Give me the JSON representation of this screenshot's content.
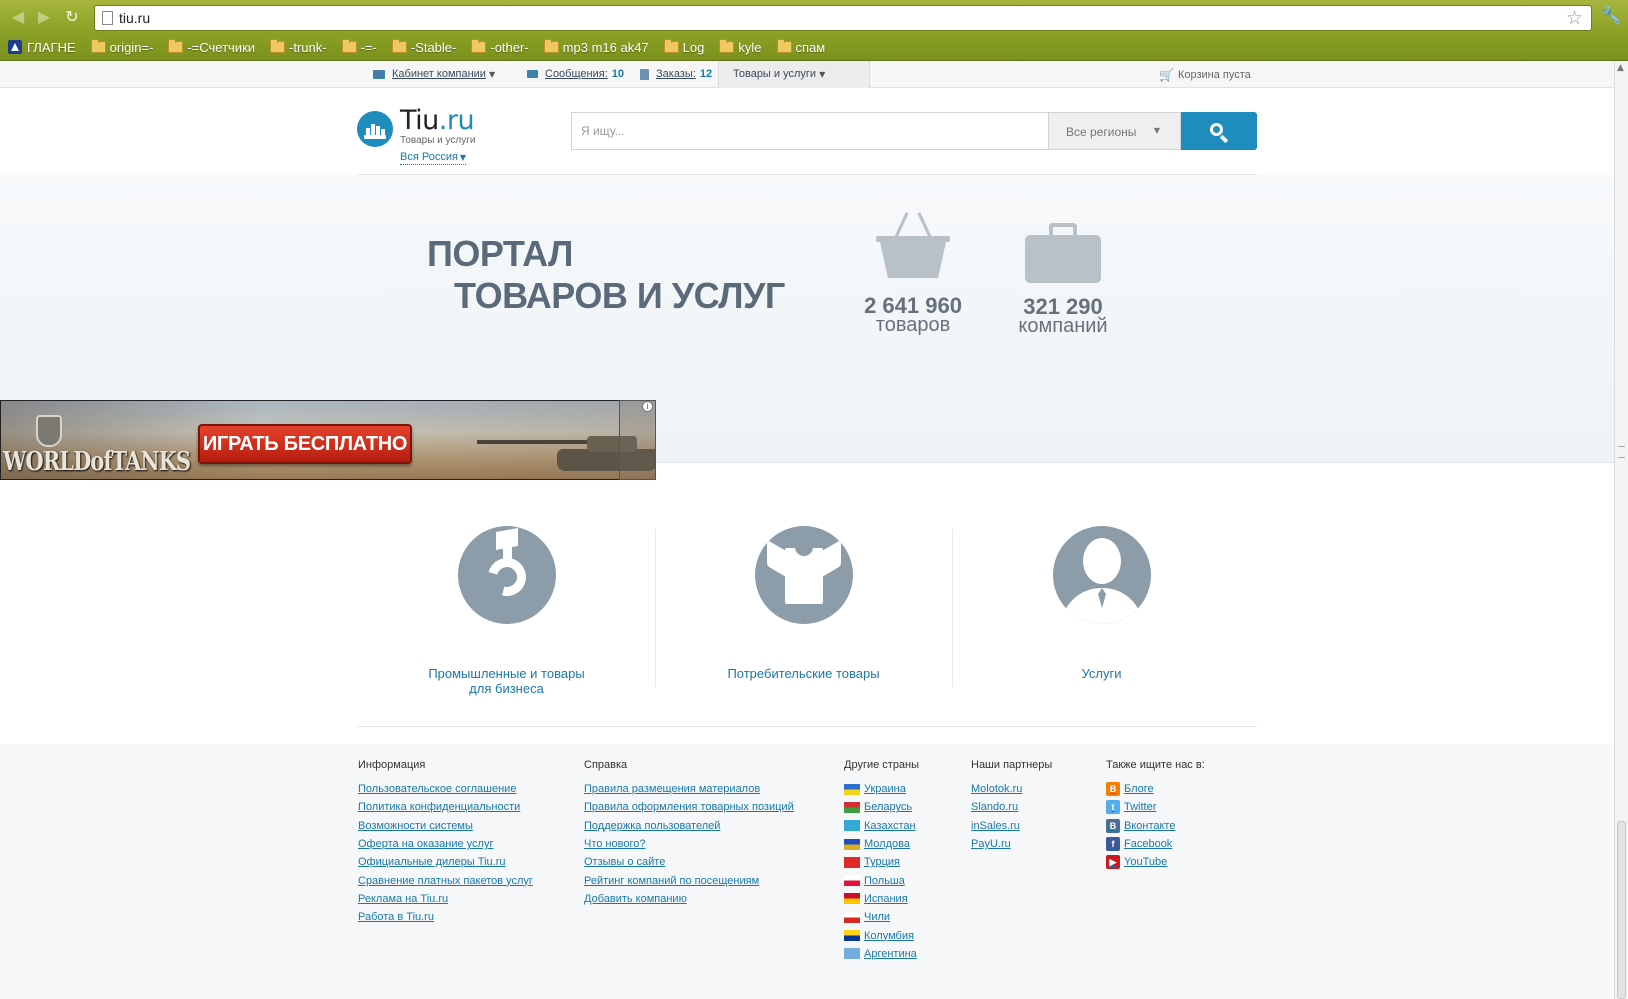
{
  "browser": {
    "url": "tiu.ru",
    "bookmarks": [
      "ГЛАГНЕ",
      "origin=-",
      "-=Счетчики",
      "-trunk-",
      "-=-",
      "-Stable-",
      "-other-",
      "mp3 m16 ak47",
      "Log",
      "kyle",
      "спам"
    ]
  },
  "topbar": {
    "cabinet": "Кабинет компании",
    "messages_label": "Сообщения:",
    "messages_count": "10",
    "orders_label": "Заказы:",
    "orders_count": "12",
    "products_menu": "Товары и услуги",
    "cart": "Корзина пуста"
  },
  "header": {
    "logo_name": "Tiu",
    "logo_tld": ".ru",
    "logo_tagline": "Товары и услуги",
    "region_link": "Вся Россия",
    "search_placeholder": "Я ищу...",
    "region_select": "Все регионы"
  },
  "hero": {
    "title_line1": "ПОРТАЛ",
    "title_line2": "ТОВАРОВ И УСЛУГ",
    "products_count": "2 641 960",
    "products_label": "товаров",
    "companies_count": "321 290",
    "companies_label": "компаний"
  },
  "ad": {
    "logo": "WORLDofTANKS",
    "cta": "ИГРАТЬ БЕСПЛАТНО",
    "info": "i"
  },
  "categories": [
    {
      "line1": "Промышленные и товары",
      "line2": "для бизнеса"
    },
    {
      "line1": "Потребительские товары",
      "line2": ""
    },
    {
      "line1": "Услуги",
      "line2": ""
    }
  ],
  "footer": {
    "info": {
      "title": "Информация",
      "links": [
        "Пользовательское соглашение",
        "Политика конфиденциальности",
        "Возможности системы",
        "Оферта на оказание услуг",
        "Официальные дилеры Tiu.ru",
        "Сравнение платных пакетов услуг",
        "Реклама на Tiu.ru",
        "Работа в Tiu.ru"
      ]
    },
    "help": {
      "title": "Справка",
      "links": [
        "Правила размещения материалов",
        "Правила оформления товарных позиций",
        "Поддержка пользователей",
        "Что нового?",
        "Отзывы о сайте",
        "Рейтинг компаний по посещениям",
        "Добавить компанию"
      ]
    },
    "countries": {
      "title": "Другие страны",
      "links": [
        "Украина",
        "Беларусь",
        "Казахстан",
        "Молдова",
        "Турция",
        "Польша",
        "Испания",
        "Чили",
        "Колумбия",
        "Аргентина"
      ],
      "flag_colors": [
        [
          "#2f6fcf",
          "#f6d41a"
        ],
        [
          "#d22f2f",
          "#3f9c3f"
        ],
        [
          "#33a9d8",
          "#33a9d8"
        ],
        [
          "#2050c0",
          "#d8b020"
        ],
        [
          "#e02a2a",
          "#e02a2a"
        ],
        [
          "#ffffff",
          "#dc143c"
        ],
        [
          "#c8102e",
          "#ffc400"
        ],
        [
          "#ffffff",
          "#d52b1e"
        ],
        [
          "#fcd116",
          "#003893"
        ],
        [
          "#74acdf",
          "#74acdf"
        ]
      ]
    },
    "partners": {
      "title": "Наши партнеры",
      "links": [
        "Molotok.ru",
        "Slando.ru",
        "inSales.ru",
        "PayU.ru"
      ]
    },
    "social": {
      "title": "Также ищите нас в:",
      "links": [
        "Блоге",
        "Twitter",
        "Вконтакте",
        "Facebook",
        "YouTube"
      ],
      "icon_colors": [
        "#f57d00",
        "#55acee",
        "#4a6d96",
        "#3b5998",
        "#cc181e"
      ],
      "icon_glyphs": [
        "B",
        "t",
        "B",
        "f",
        "▶"
      ]
    }
  },
  "colors": {
    "accent": "#1e8cbc",
    "link": "#1a79a8",
    "ad_button": "#d2321f",
    "icon_gray": "#8c9ca8"
  }
}
